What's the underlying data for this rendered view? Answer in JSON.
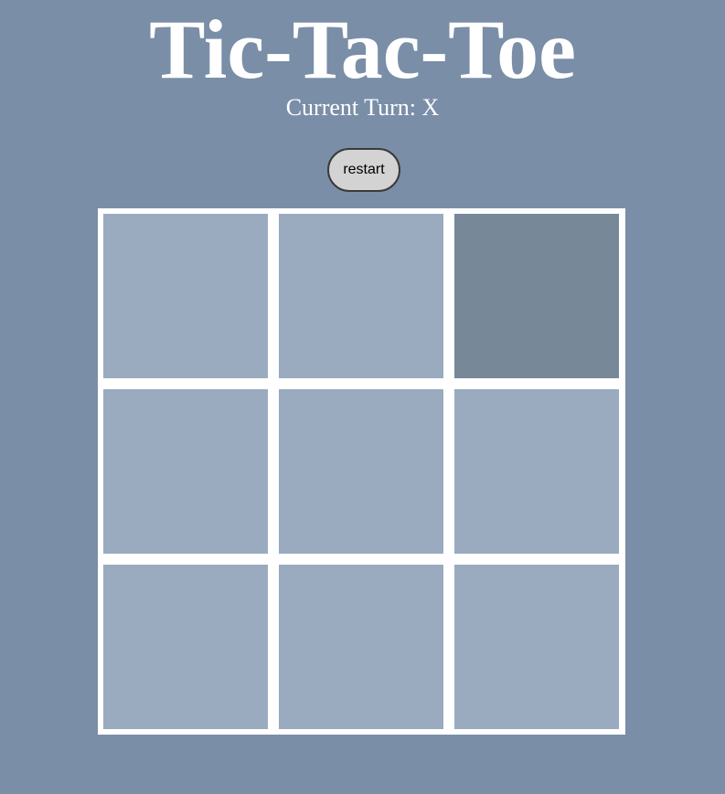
{
  "title": "Tic-Tac-Toe",
  "turn_text": "Current Turn: X",
  "restart_label": "restart",
  "board": {
    "cells": [
      "",
      "",
      "",
      "",
      "",
      "",
      "",
      "",
      ""
    ],
    "hovered_cell": 2
  },
  "colors": {
    "background": "#7a8ea8",
    "cell": "#9aabbf",
    "cell_hover": "#778899",
    "grid_lines": "#ffffff",
    "button": "#d3d3d3"
  }
}
